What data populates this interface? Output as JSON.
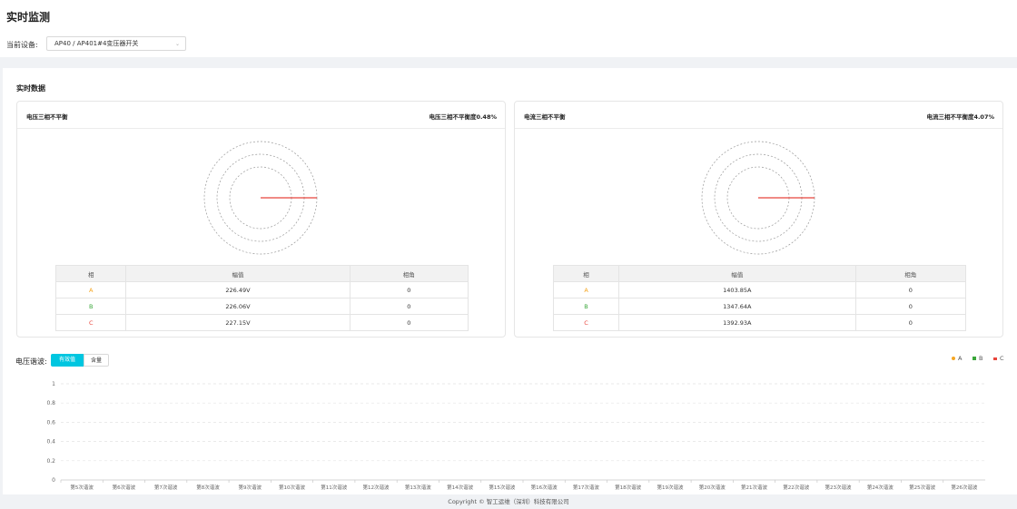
{
  "page": {
    "title": "实时监测"
  },
  "device": {
    "label": "当前设备:",
    "selected": "AP40 / AP401#4变压器开关"
  },
  "section": {
    "title": "实时数据"
  },
  "voltage_card": {
    "title": "电压三相不平衡",
    "metric": "电压三相不平衡度0.48%",
    "headers": [
      "相",
      "幅值",
      "相角"
    ],
    "rows": [
      {
        "phase": "A",
        "magnitude": "226.49V",
        "angle": "0"
      },
      {
        "phase": "B",
        "magnitude": "226.06V",
        "angle": "0"
      },
      {
        "phase": "C",
        "magnitude": "227.15V",
        "angle": "0"
      }
    ]
  },
  "current_card": {
    "title": "电流三相不平衡",
    "metric": "电流三相不平衡度4.07%",
    "headers": [
      "相",
      "幅值",
      "相角"
    ],
    "rows": [
      {
        "phase": "A",
        "magnitude": "1403.85A",
        "angle": "0"
      },
      {
        "phase": "B",
        "magnitude": "1347.64A",
        "angle": "0"
      },
      {
        "phase": "C",
        "magnitude": "1392.93A",
        "angle": "0"
      }
    ]
  },
  "phase_colors": {
    "A": "#f5a623",
    "B": "#3aa63a",
    "C": "#e8453c"
  },
  "harmonics": {
    "title": "电压谐波:",
    "tabs": [
      "有效值",
      "含量"
    ],
    "active_tab": "有效值",
    "legend": [
      {
        "name": "A",
        "color": "#f5a623"
      },
      {
        "name": "B",
        "color": "#3aa63a"
      },
      {
        "name": "C",
        "color": "#e8453c"
      }
    ]
  },
  "chart_data": {
    "type": "bar",
    "ylim": [
      0,
      1
    ],
    "yticks": [
      "0",
      "0.2",
      "0.4",
      "0.6",
      "0.8",
      "1"
    ],
    "categories": [
      "第5次谐波",
      "第6次谐波",
      "第7次谐波",
      "第8次谐波",
      "第9次谐波",
      "第10次谐波",
      "第11次谐波",
      "第12次谐波",
      "第13次谐波",
      "第14次谐波",
      "第15次谐波",
      "第16次谐波",
      "第17次谐波",
      "第18次谐波",
      "第19次谐波",
      "第20次谐波",
      "第21次谐波",
      "第22次谐波",
      "第23次谐波",
      "第24次谐波",
      "第25次谐波",
      "第26次谐波"
    ],
    "series": [
      {
        "name": "A",
        "values": [
          0,
          0,
          0,
          0,
          0,
          0,
          0,
          0,
          0,
          0,
          0,
          0,
          0,
          0,
          0,
          0,
          0,
          0,
          0,
          0,
          0,
          0
        ]
      },
      {
        "name": "B",
        "values": [
          0,
          0,
          0,
          0,
          0,
          0,
          0,
          0,
          0,
          0,
          0,
          0,
          0,
          0,
          0,
          0,
          0,
          0,
          0,
          0,
          0,
          0
        ]
      },
      {
        "name": "C",
        "values": [
          0,
          0,
          0,
          0,
          0,
          0,
          0,
          0,
          0,
          0,
          0,
          0,
          0,
          0,
          0,
          0,
          0,
          0,
          0,
          0,
          0,
          0
        ]
      }
    ],
    "grid": true
  },
  "footer": {
    "text": "Copyright © 智工运维（深圳）科技有限公司"
  }
}
